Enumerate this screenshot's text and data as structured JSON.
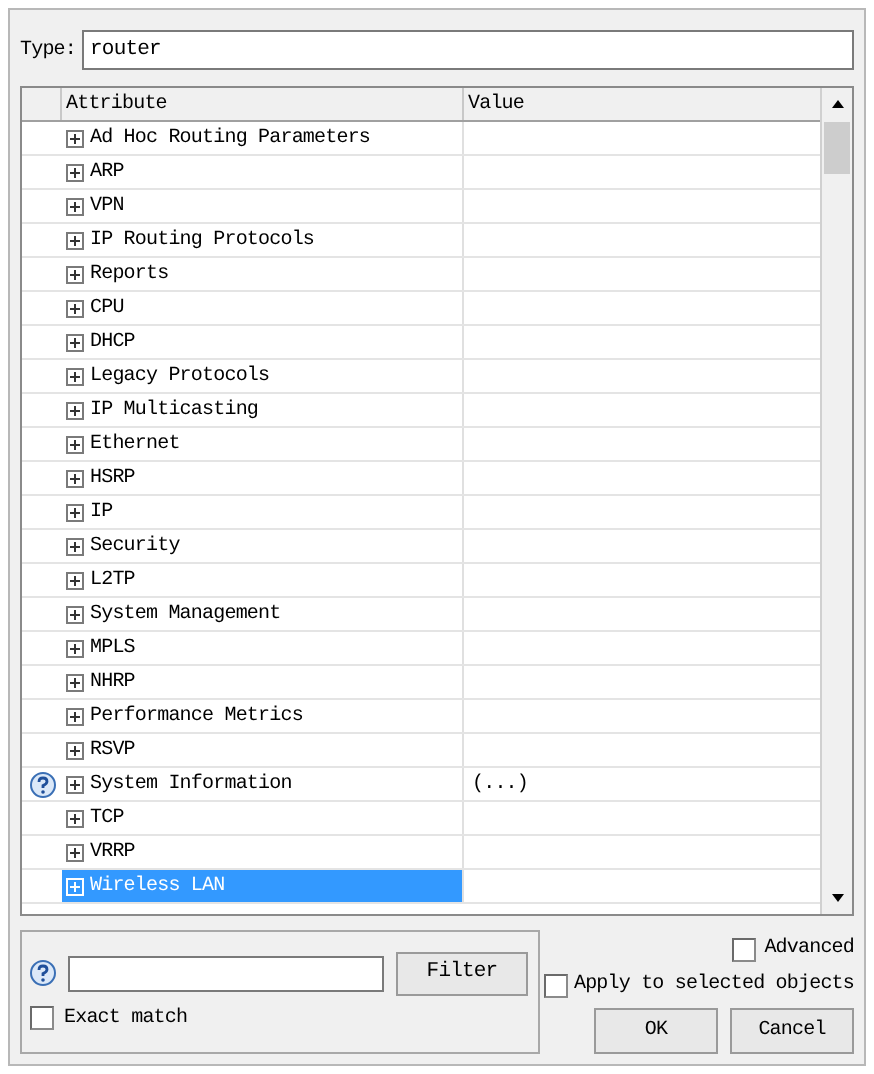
{
  "type_field": {
    "label": "Type:",
    "value": "router"
  },
  "table": {
    "columns": [
      "Attribute",
      "Value"
    ],
    "rows": [
      {
        "attribute": "Ad Hoc Routing Parameters",
        "value": "",
        "help": false,
        "selected": false
      },
      {
        "attribute": "ARP",
        "value": "",
        "help": false,
        "selected": false
      },
      {
        "attribute": "VPN",
        "value": "",
        "help": false,
        "selected": false
      },
      {
        "attribute": "IP Routing Protocols",
        "value": "",
        "help": false,
        "selected": false
      },
      {
        "attribute": "Reports",
        "value": "",
        "help": false,
        "selected": false
      },
      {
        "attribute": "CPU",
        "value": "",
        "help": false,
        "selected": false
      },
      {
        "attribute": "DHCP",
        "value": "",
        "help": false,
        "selected": false
      },
      {
        "attribute": "Legacy Protocols",
        "value": "",
        "help": false,
        "selected": false
      },
      {
        "attribute": "IP Multicasting",
        "value": "",
        "help": false,
        "selected": false
      },
      {
        "attribute": "Ethernet",
        "value": "",
        "help": false,
        "selected": false
      },
      {
        "attribute": "HSRP",
        "value": "",
        "help": false,
        "selected": false
      },
      {
        "attribute": "IP",
        "value": "",
        "help": false,
        "selected": false
      },
      {
        "attribute": "Security",
        "value": "",
        "help": false,
        "selected": false
      },
      {
        "attribute": "L2TP",
        "value": "",
        "help": false,
        "selected": false
      },
      {
        "attribute": "System Management",
        "value": "",
        "help": false,
        "selected": false
      },
      {
        "attribute": "MPLS",
        "value": "",
        "help": false,
        "selected": false
      },
      {
        "attribute": "NHRP",
        "value": "",
        "help": false,
        "selected": false
      },
      {
        "attribute": "Performance Metrics",
        "value": "",
        "help": false,
        "selected": false
      },
      {
        "attribute": "RSVP",
        "value": "",
        "help": false,
        "selected": false
      },
      {
        "attribute": "System Information",
        "value": "(...)",
        "help": true,
        "selected": false
      },
      {
        "attribute": "TCP",
        "value": "",
        "help": false,
        "selected": false
      },
      {
        "attribute": "VRRP",
        "value": "",
        "help": false,
        "selected": false
      },
      {
        "attribute": "Wireless LAN",
        "value": "",
        "help": false,
        "selected": true
      }
    ]
  },
  "filter": {
    "button": "Filter",
    "exact_match": {
      "label": "Exact match",
      "checked": false
    }
  },
  "advanced": {
    "label": "Advanced",
    "checked": false
  },
  "apply_selected": {
    "label": "Apply to selected objects",
    "checked": false
  },
  "buttons": [
    "OK",
    "Cancel"
  ]
}
